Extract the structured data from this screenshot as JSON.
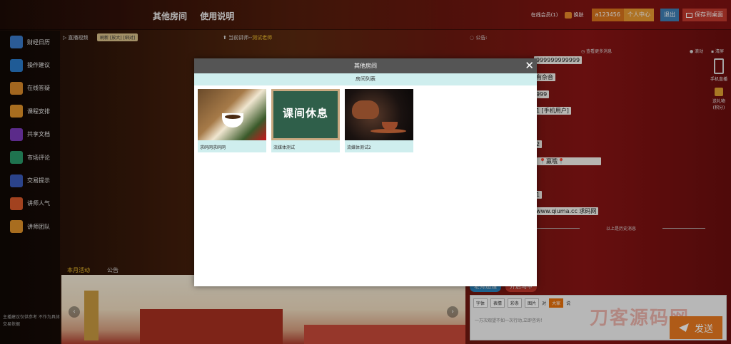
{
  "topbar": {
    "nav": [
      "其他房间",
      "使用说明"
    ],
    "online": "在线会员(1)",
    "skin": "换肤",
    "username": "a123456",
    "user_center": "个人中心",
    "logout": "退出",
    "save_desktop": "保存到桌面"
  },
  "sidebar": {
    "items": [
      {
        "label": "财经日历",
        "icon": "calendar-icon",
        "color": "#3a7ac8"
      },
      {
        "label": "操作建议",
        "icon": "bell-icon",
        "color": "#2a7ac8"
      },
      {
        "label": "在线答疑",
        "icon": "document-icon",
        "color": "#d8882a"
      },
      {
        "label": "课程安排",
        "icon": "teacher-icon",
        "color": "#e0922a"
      },
      {
        "label": "共享文档",
        "icon": "chart-line-icon",
        "color": "#7a3ab8"
      },
      {
        "label": "市场评论",
        "icon": "books-icon",
        "color": "#2a9a6a"
      },
      {
        "label": "交易提示",
        "icon": "mail-icon",
        "color": "#3a5ab8"
      },
      {
        "label": "讲师人气",
        "icon": "thumbs-up-icon",
        "color": "#d8582a"
      },
      {
        "label": "讲师团队",
        "icon": "person-icon",
        "color": "#e0922a"
      }
    ],
    "note": "主播建议仅供参考 不作为具体交易依据"
  },
  "video": {
    "live_label": "直播视频",
    "refresh_label": "刷新 [放大] [绑对]",
    "teacher_prefix": "当前讲师--",
    "teacher_name": "测试老师"
  },
  "chat": {
    "notice_label": "公告:",
    "more_messages": "查看更多消息",
    "scroll": "滚动",
    "clear": "清屏",
    "messages": [
      "999999999999",
      "有杂音",
      "999",
      "1 [手机用户]",
      "2",
      "📍赢哦📍",
      "1",
      "www.qiuma.cc 求码网"
    ],
    "history_line": "以上是历史消息",
    "btn_teacher": "老师加理",
    "btn_vest": "开启马甲",
    "tool_font": "字体",
    "tool_emoji": "表情",
    "tool_bar": "彩条",
    "tool_image": "图片",
    "tool_to": "对",
    "tool_all": "大家",
    "tool_say": "说",
    "placeholder": "一万次观望不如一次行动,立即咨询！",
    "send": "发送"
  },
  "right_strip": {
    "mobile": "手机直播",
    "gift": "送礼物",
    "gift_points": "(积分)"
  },
  "bottom_tabs": [
    "本月活动",
    "公告"
  ],
  "modal": {
    "title": "其他房间",
    "subtitle": "房间列表",
    "close_glyph": "✕",
    "rooms": [
      {
        "name": "求码网求码网"
      },
      {
        "name": "流媒体测试",
        "board_text": "课间休息"
      },
      {
        "name": "流媒体测试2"
      }
    ]
  },
  "watermark": "刀客源码网"
}
